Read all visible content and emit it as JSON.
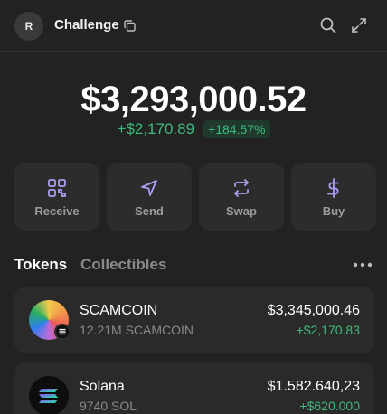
{
  "header": {
    "avatar_letter": "R",
    "account_name": "Challenge"
  },
  "balance": {
    "total": "$3,293,000.52",
    "change_value": "+$2,170.89",
    "change_percent": "+184.57%"
  },
  "actions": [
    {
      "label": "Receive",
      "icon": "qr-code-icon"
    },
    {
      "label": "Send",
      "icon": "send-icon"
    },
    {
      "label": "Swap",
      "icon": "swap-icon"
    },
    {
      "label": "Buy",
      "icon": "dollar-icon"
    }
  ],
  "tabs": {
    "tokens": "Tokens",
    "collectibles": "Collectibles"
  },
  "tokens": [
    {
      "name": "SCAMCOIN",
      "amount": "12.21M SCAMCOIN",
      "value": "$3,345,000.46",
      "change": "+$2,170.83"
    },
    {
      "name": "Solana",
      "amount": "9740 SOL",
      "value": "$1.582.640,23",
      "change": "+$620.000"
    }
  ],
  "colors": {
    "accent": "#ab9ff2",
    "positive": "#3fb97b",
    "background": "#222222"
  }
}
